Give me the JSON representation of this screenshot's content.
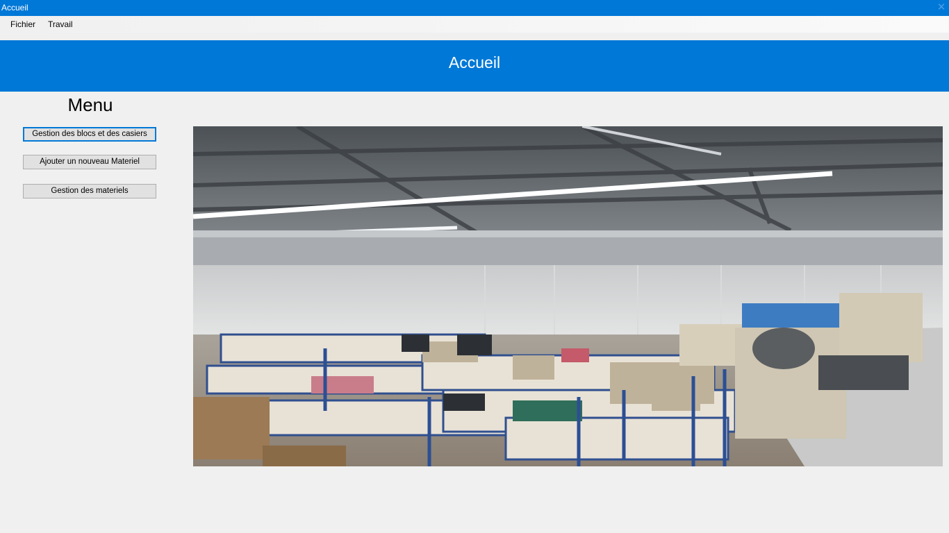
{
  "window": {
    "title": "Accueil",
    "close_icon": "close-icon",
    "accent_color": "#0078d7"
  },
  "menubar": {
    "items": [
      {
        "label": "Fichier"
      },
      {
        "label": "Travail"
      }
    ]
  },
  "header": {
    "title": "Accueil"
  },
  "sidebar": {
    "heading": "Menu",
    "buttons": [
      {
        "label": "Gestion des blocs et des casiers",
        "focused": true
      },
      {
        "label": "Ajouter un nouveau Materiel",
        "focused": false
      },
      {
        "label": "Gestion des materiels",
        "focused": false
      }
    ]
  },
  "main": {
    "image": "warehouse-photo"
  }
}
